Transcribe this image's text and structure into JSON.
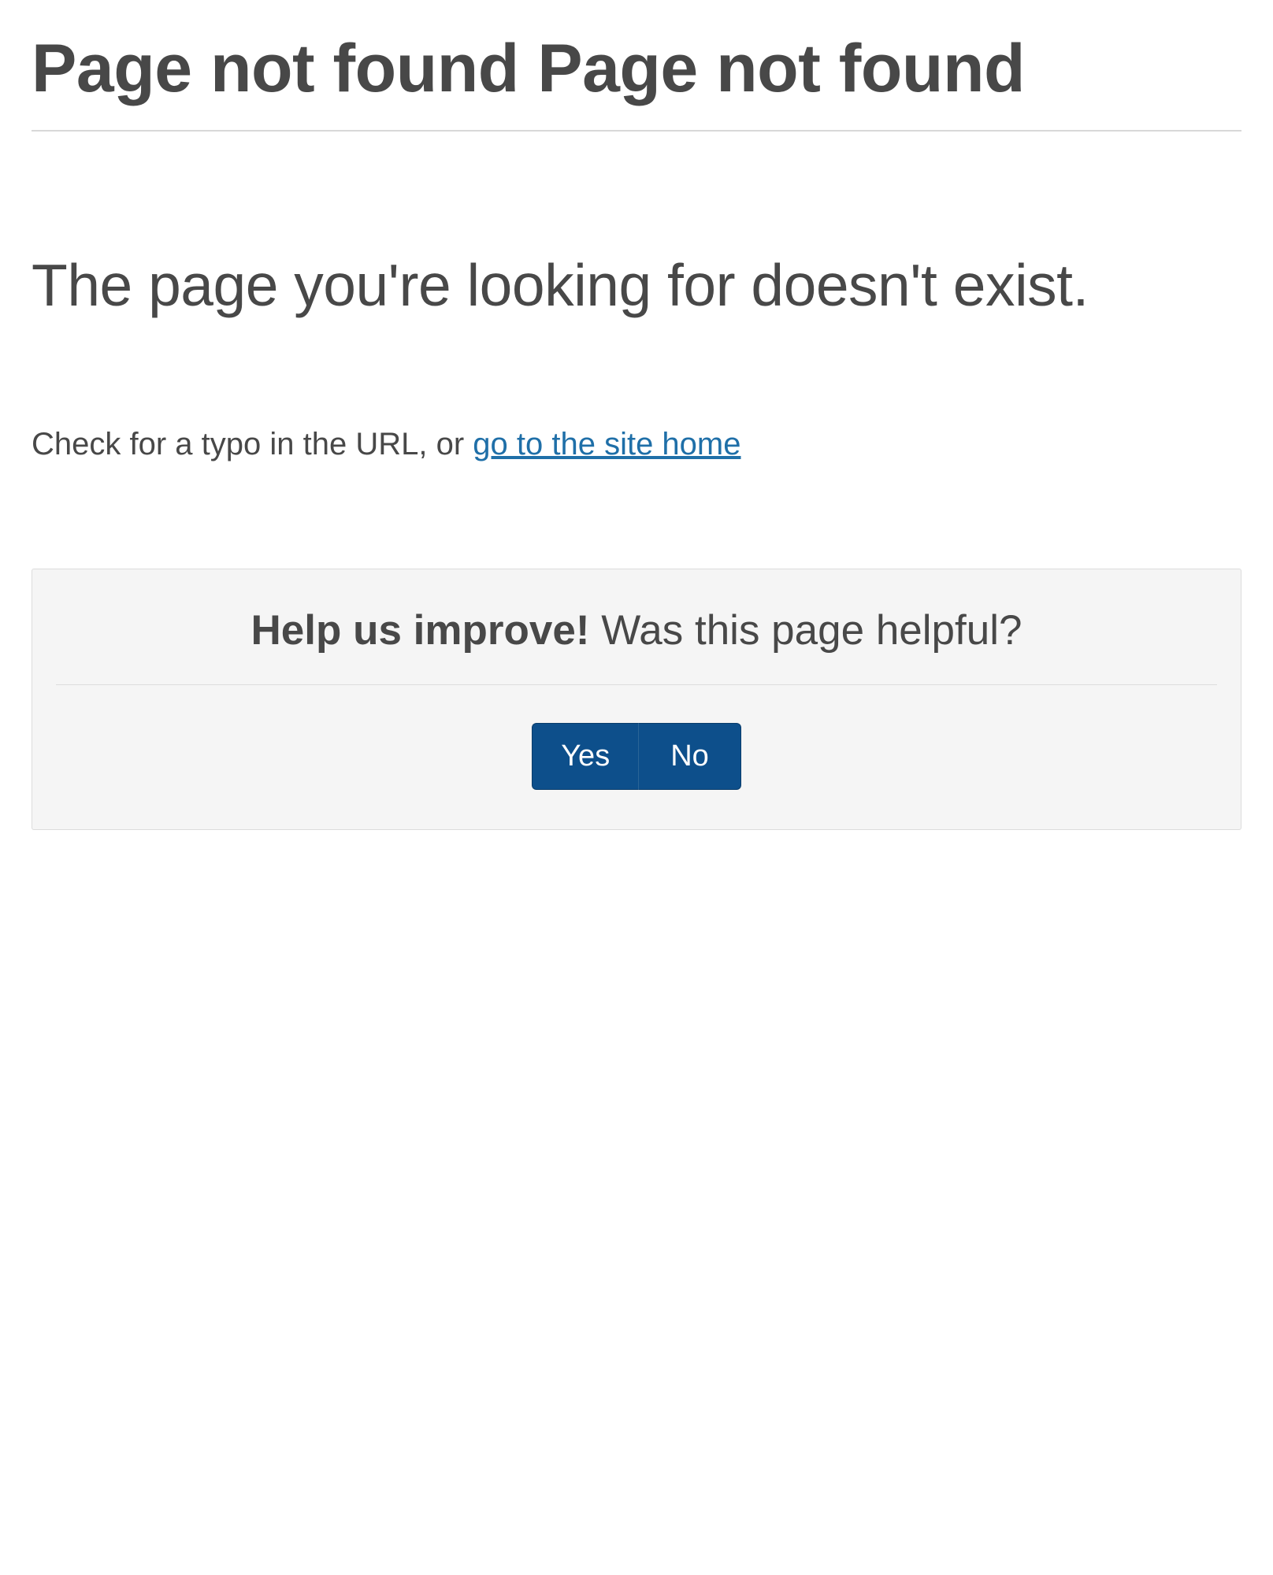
{
  "page": {
    "title": "Page not found Page not found",
    "subtitle": "The page you're looking for doesn't exist.",
    "hint_prefix": "Check for a typo in the URL, or ",
    "home_link_text": "go to the site home"
  },
  "feedback": {
    "heading_bold": "Help us improve!",
    "heading_rest": " Was this page helpful?",
    "yes_label": "Yes",
    "no_label": "No"
  }
}
